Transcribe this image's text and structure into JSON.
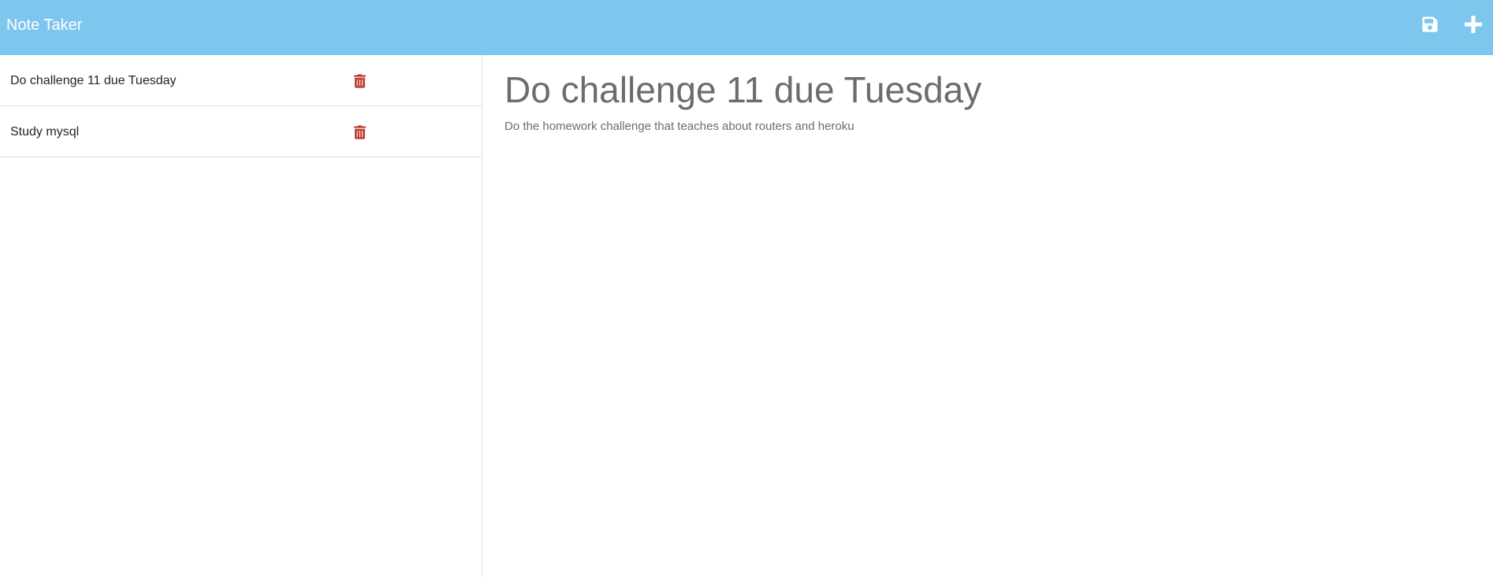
{
  "app": {
    "title": "Note Taker"
  },
  "toolbar": {
    "save_icon": "save-icon",
    "new_icon": "plus-icon"
  },
  "colors": {
    "navbar": "#7dc6ed",
    "delete": "#c0392b",
    "text": "#212529",
    "editor_text": "#6c6c6c"
  },
  "notes": [
    {
      "title": "Do challenge 11 due Tuesday",
      "delete_icon": "trash-icon"
    },
    {
      "title": "Study mysql",
      "delete_icon": "trash-icon"
    }
  ],
  "active_note": {
    "title": "Do challenge 11 due Tuesday",
    "text": "Do the homework challenge that teaches about routers and heroku"
  }
}
